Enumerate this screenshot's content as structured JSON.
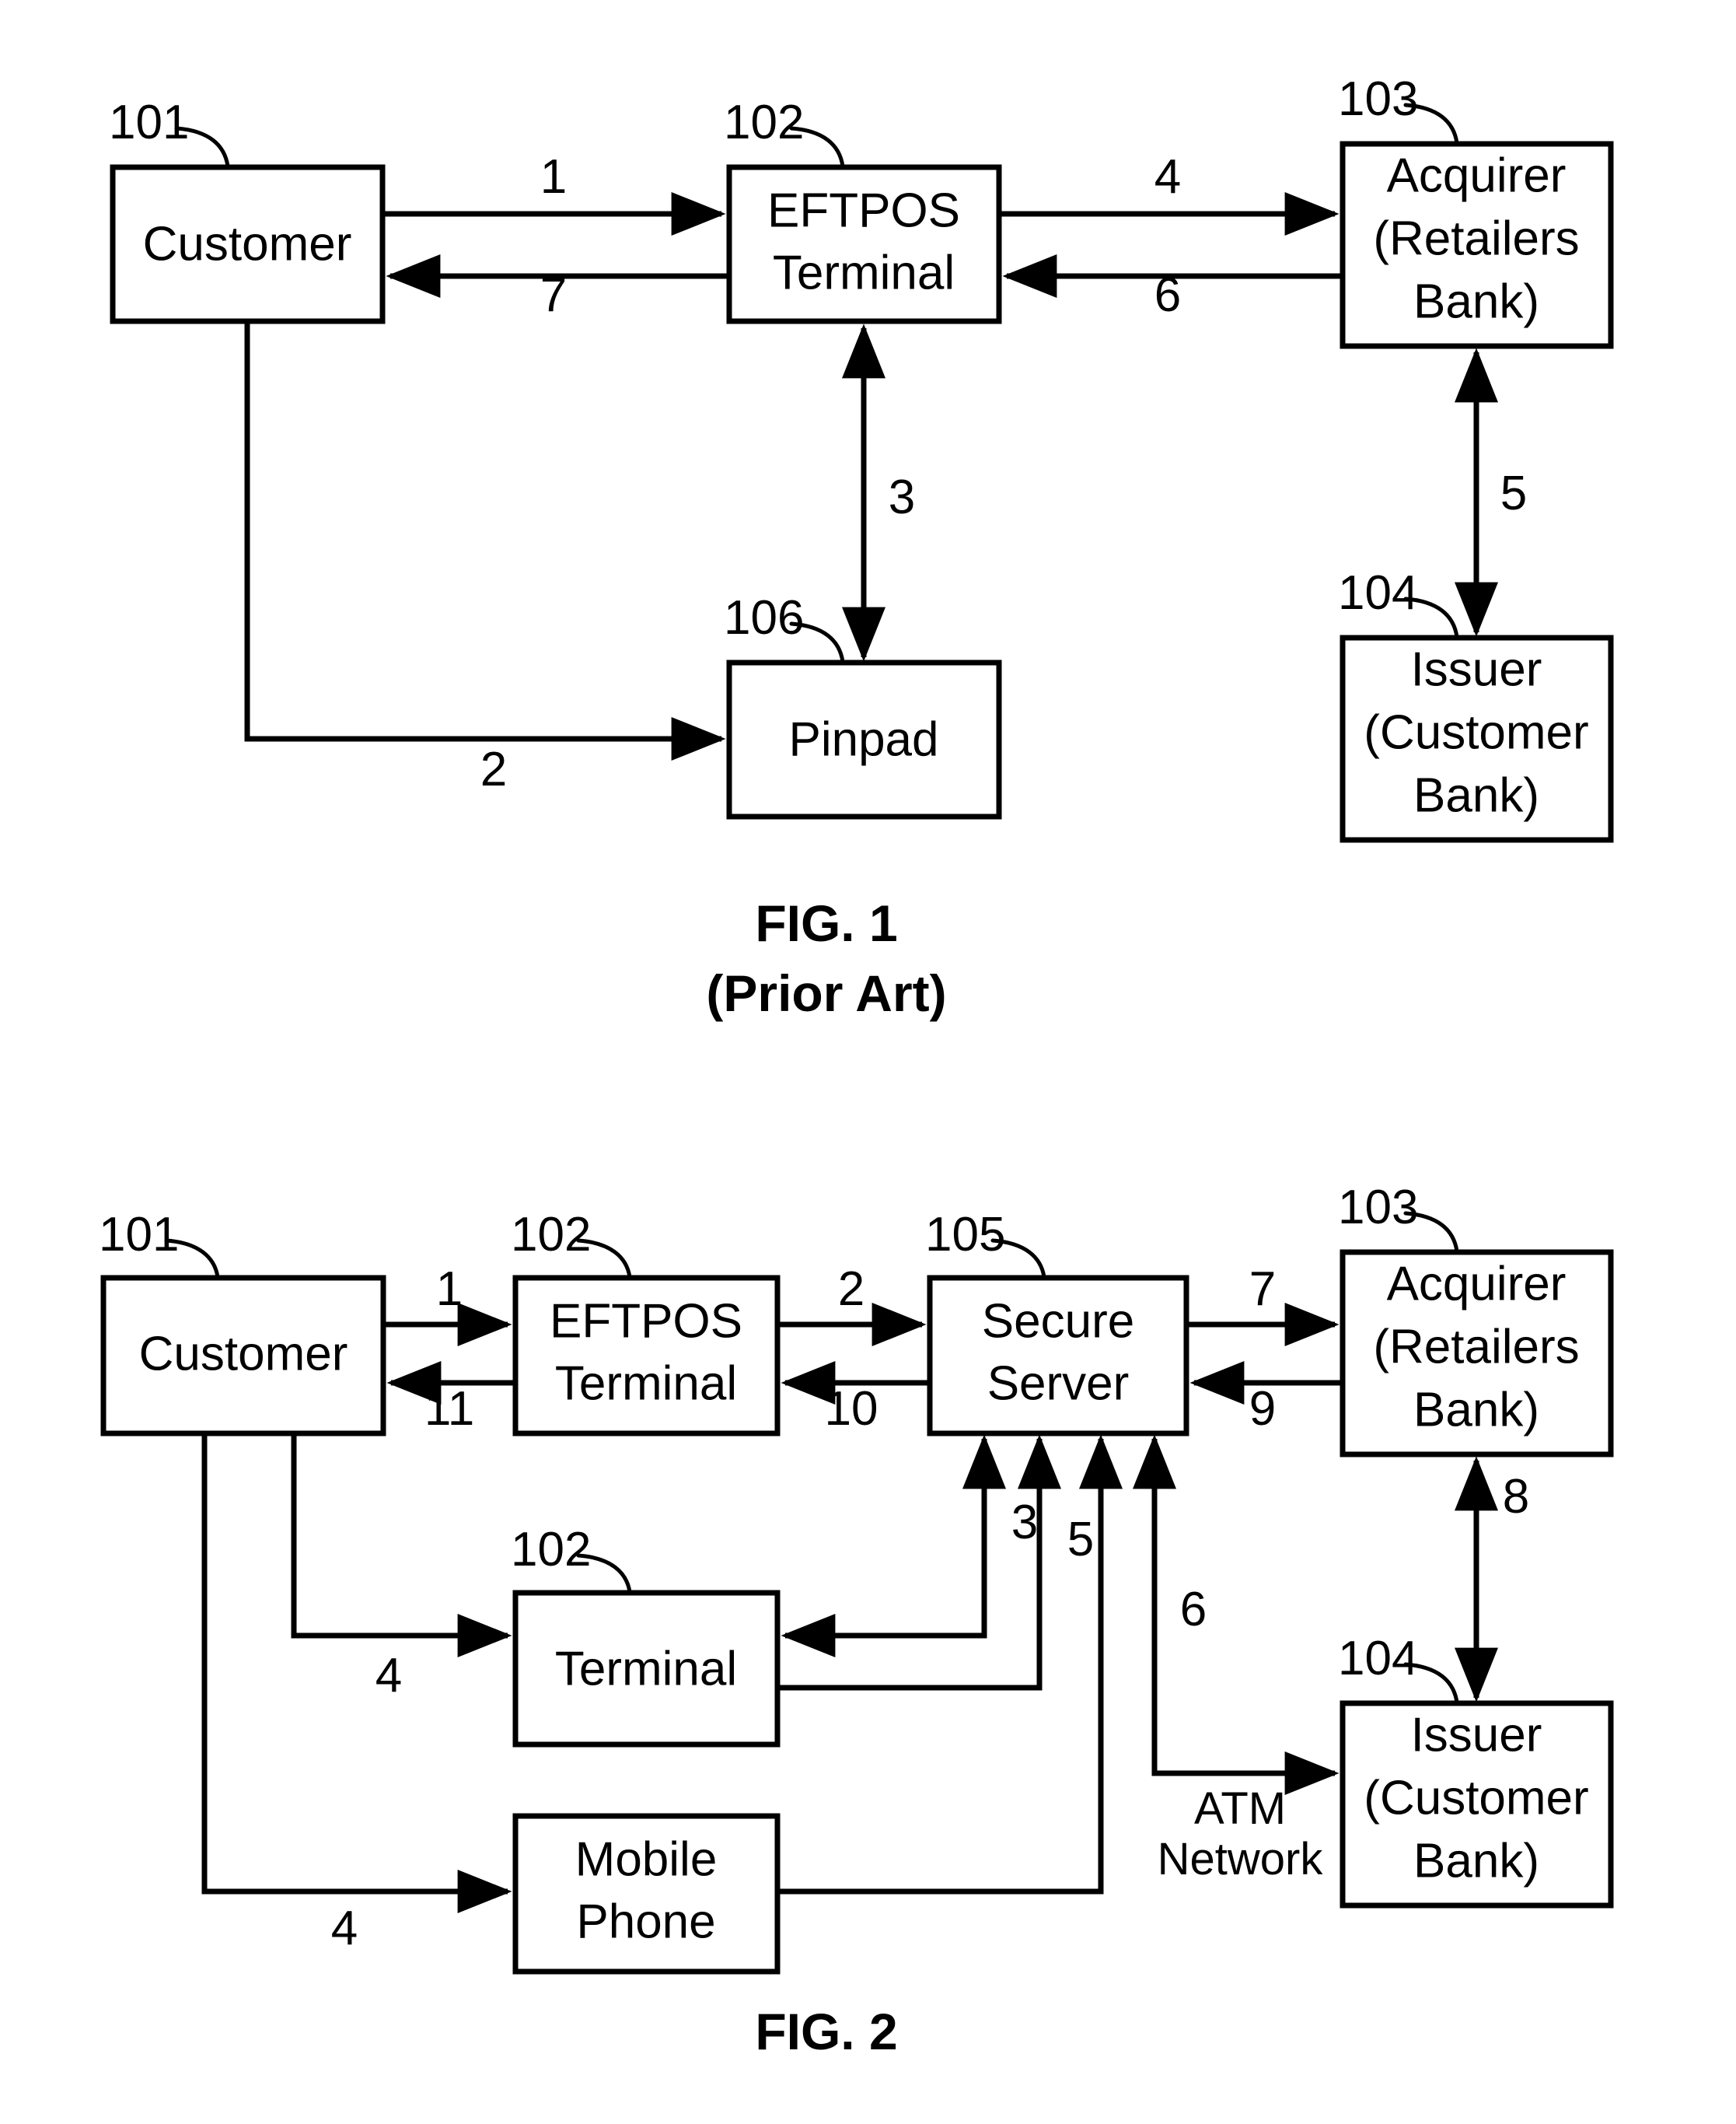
{
  "document": {
    "type": "patent-figure-sheet",
    "figures": [
      {
        "id": "fig1",
        "caption_line1": "FIG. 1",
        "caption_line2": "(Prior Art)",
        "boxes": [
          {
            "ref": "101",
            "label_line1": "Customer",
            "label_line2": ""
          },
          {
            "ref": "102",
            "label_line1": "EFTPOS",
            "label_line2": "Terminal"
          },
          {
            "ref": "103",
            "label_line1": "Acquirer",
            "label_line2": "(Retailers",
            "label_line3": "Bank)"
          },
          {
            "ref": "106",
            "label_line1": "Pinpad",
            "label_line2": ""
          },
          {
            "ref": "104",
            "label_line1": "Issuer",
            "label_line2": "(Customer",
            "label_line3": "Bank)"
          }
        ],
        "steps": [
          {
            "num": "1",
            "from": "Customer",
            "to": "EFTPOS Terminal"
          },
          {
            "num": "7",
            "from": "EFTPOS Terminal",
            "to": "Customer"
          },
          {
            "num": "2",
            "from": "Customer",
            "to": "Pinpad"
          },
          {
            "num": "3",
            "from": "Pinpad",
            "to": "EFTPOS Terminal"
          },
          {
            "num": "4",
            "from": "EFTPOS Terminal",
            "to": "Acquirer (Retailers Bank)"
          },
          {
            "num": "6",
            "from": "Acquirer (Retailers Bank)",
            "to": "EFTPOS Terminal"
          },
          {
            "num": "5",
            "from": "Acquirer (Retailers Bank)",
            "to": "Issuer (Customer Bank)"
          }
        ]
      },
      {
        "id": "fig2",
        "caption_line1": "FIG. 2",
        "caption_line2": "",
        "boxes": [
          {
            "ref": "101",
            "label_line1": "Customer",
            "label_line2": ""
          },
          {
            "ref": "102",
            "label_line1": "EFTPOS",
            "label_line2": "Terminal"
          },
          {
            "ref": "105",
            "label_line1": "Secure",
            "label_line2": "Server"
          },
          {
            "ref": "103",
            "label_line1": "Acquirer",
            "label_line2": "(Retailers",
            "label_line3": "Bank)"
          },
          {
            "ref": "102",
            "label_line1": "Terminal",
            "label_line2": ""
          },
          {
            "ref": "104",
            "label_line1": "Issuer",
            "label_line2": "(Customer",
            "label_line3": "Bank)"
          },
          {
            "ref": "",
            "label_line1": "Mobile",
            "label_line2": "Phone"
          }
        ],
        "annotations": [
          {
            "line1": "ATM",
            "line2": "Network"
          }
        ],
        "steps": [
          {
            "num": "1",
            "from": "Customer",
            "to": "EFTPOS Terminal"
          },
          {
            "num": "11",
            "from": "EFTPOS Terminal",
            "to": "Customer"
          },
          {
            "num": "2",
            "from": "EFTPOS Terminal",
            "to": "Secure Server"
          },
          {
            "num": "10",
            "from": "Secure Server",
            "to": "EFTPOS Terminal"
          },
          {
            "num": "3",
            "from": "Secure Server",
            "to": "Terminal"
          },
          {
            "num": "4",
            "from": "Customer",
            "to": "Terminal"
          },
          {
            "num": "5",
            "from": "Terminal",
            "to": "Secure Server"
          },
          {
            "num": "4",
            "from": "Customer",
            "to": "Mobile Phone"
          },
          {
            "num": "6",
            "from": "Secure Server",
            "to": "Issuer (Customer Bank)"
          },
          {
            "num": "7",
            "from": "Secure Server",
            "to": "Acquirer (Retailers Bank)"
          },
          {
            "num": "9",
            "from": "Acquirer (Retailers Bank)",
            "to": "Secure Server"
          },
          {
            "num": "8",
            "from": "Acquirer (Retailers Bank)",
            "to": "Issuer (Customer Bank)"
          }
        ]
      }
    ]
  },
  "fig1": {
    "caption1": "FIG. 1",
    "caption2": "(Prior Art)",
    "ref101": "101",
    "ref102": "102",
    "ref103": "103",
    "ref104": "104",
    "ref106": "106",
    "customer": "Customer",
    "eftpos1": "EFTPOS",
    "eftpos2": "Terminal",
    "acquirer1": "Acquirer",
    "acquirer2": "(Retailers",
    "acquirer3": "Bank)",
    "pinpad": "Pinpad",
    "issuer1": "Issuer",
    "issuer2": "(Customer",
    "issuer3": "Bank)",
    "s1": "1",
    "s2": "2",
    "s3": "3",
    "s4": "4",
    "s5": "5",
    "s6": "6",
    "s7": "7"
  },
  "fig2": {
    "caption1": "FIG. 2",
    "ref101": "101",
    "ref102a": "102",
    "ref102b": "102",
    "ref103": "103",
    "ref104": "104",
    "ref105": "105",
    "customer": "Customer",
    "eftpos1": "EFTPOS",
    "eftpos2": "Terminal",
    "secure1": "Secure",
    "secure2": "Server",
    "acquirer1": "Acquirer",
    "acquirer2": "(Retailers",
    "acquirer3": "Bank)",
    "terminal": "Terminal",
    "issuer1": "Issuer",
    "issuer2": "(Customer",
    "issuer3": "Bank)",
    "mobile1": "Mobile",
    "mobile2": "Phone",
    "atm1": "ATM",
    "atm2": "Network",
    "s1": "1",
    "s2": "2",
    "s3": "3",
    "s4a": "4",
    "s4b": "4",
    "s5": "5",
    "s6": "6",
    "s7": "7",
    "s8": "8",
    "s9": "9",
    "s10": "10",
    "s11": "11"
  },
  "colors": {
    "ink": "#000000",
    "paper": "#ffffff"
  }
}
